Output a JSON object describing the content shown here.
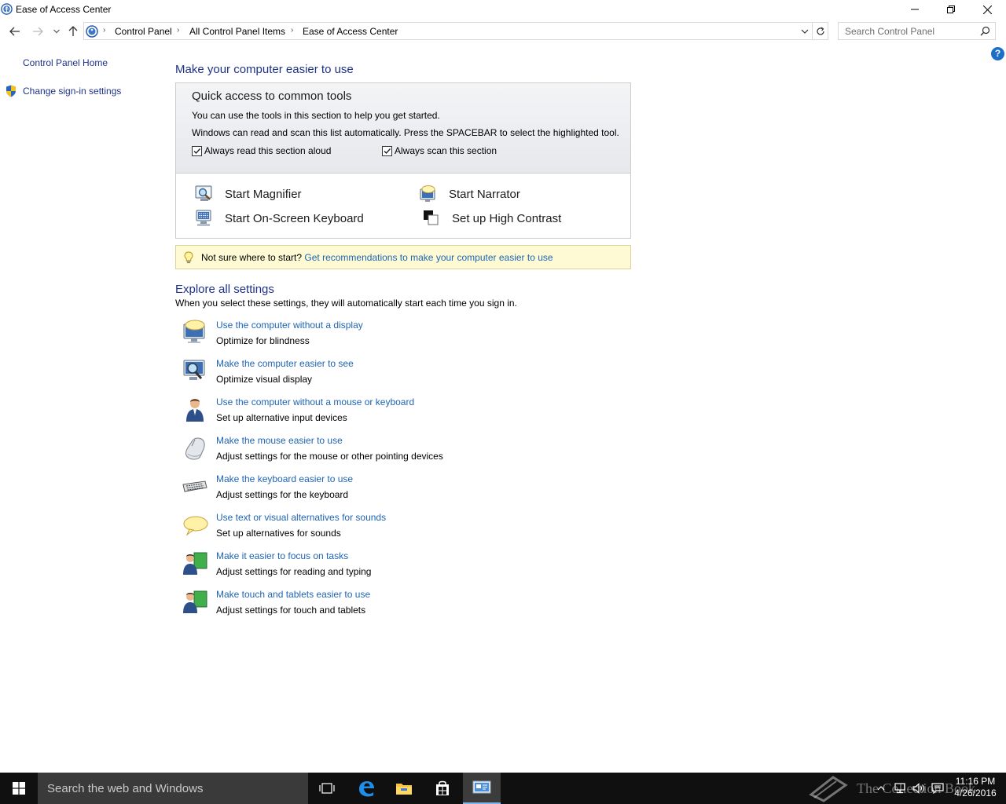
{
  "window": {
    "title": "Ease of Access Center",
    "controls": [
      "minimize",
      "restore",
      "close"
    ]
  },
  "address": {
    "breadcrumbs": [
      "Control Panel",
      "All Control Panel Items",
      "Ease of Access Center"
    ],
    "search_placeholder": "Search Control Panel"
  },
  "left_pane": {
    "home_link": "Control Panel Home",
    "signin_link": "Change sign-in settings"
  },
  "main": {
    "heading": "Make your computer easier to use",
    "quick_access": {
      "title": "Quick access to common tools",
      "line1": "You can use the tools in this section to help you get started.",
      "line2": "Windows can read and scan this list automatically.  Press the SPACEBAR to select the highlighted tool.",
      "checkbox_read": {
        "label": "Always read this section aloud",
        "checked": true
      },
      "checkbox_scan": {
        "label": "Always scan this section",
        "checked": true
      },
      "tools": {
        "magnifier": "Start Magnifier",
        "narrator": "Start Narrator",
        "osk": "Start On-Screen Keyboard",
        "contrast": "Set up High Contrast"
      }
    },
    "tip": {
      "prefix": "Not sure where to start?",
      "link": "Get recommendations to make your computer easier to use"
    },
    "explore": {
      "heading": "Explore all settings",
      "description": "When you select these settings, they will automatically start each time you sign in.",
      "items": [
        {
          "link": "Use the computer without a display",
          "desc": "Optimize for blindness",
          "icon": "display-icon"
        },
        {
          "link": "Make the computer easier to see",
          "desc": "Optimize visual display",
          "icon": "monitor-magnifier-icon"
        },
        {
          "link": "Use the computer without a mouse or keyboard",
          "desc": "Set up alternative input devices",
          "icon": "person-icon"
        },
        {
          "link": "Make the mouse easier to use",
          "desc": "Adjust settings for the mouse or other pointing devices",
          "icon": "mouse-icon"
        },
        {
          "link": "Make the keyboard easier to use",
          "desc": "Adjust settings for the keyboard",
          "icon": "keyboard-icon"
        },
        {
          "link": "Use text or visual alternatives for sounds",
          "desc": "Set up alternatives for sounds",
          "icon": "speech-bubble-icon"
        },
        {
          "link": "Make it easier to focus on tasks",
          "desc": "Adjust settings for reading and typing",
          "icon": "people-icon"
        },
        {
          "link": "Make touch and tablets easier to use",
          "desc": "Adjust settings for touch and tablets",
          "icon": "people-icon"
        }
      ]
    }
  },
  "taskbar": {
    "search_placeholder": "Search the web and Windows",
    "time": "11:16 PM",
    "date": "4/26/2016",
    "watermark": "The Collection Book"
  },
  "colors": {
    "link": "#1e64b4",
    "heading": "#1e3287",
    "taskbar": "#101010",
    "tip_background": "#fefbd4"
  }
}
